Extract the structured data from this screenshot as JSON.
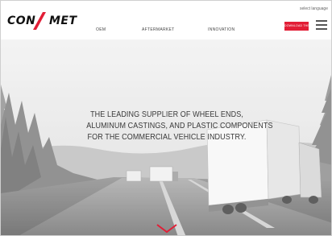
{
  "header": {
    "language_label": "select language",
    "logo": {
      "left": "CON",
      "right": "MET",
      "accent_color": "#e21e36"
    },
    "nav": [
      {
        "label": "OEM"
      },
      {
        "label": "AFTERMARKET"
      },
      {
        "label": "INNOVATION"
      }
    ],
    "download_button": "DOWNLOAD THE APP",
    "menu_icon": "hamburger-menu-icon"
  },
  "hero": {
    "headline": [
      "THE LEADING SUPPLIER OF WHEEL ENDS,",
      "ALUMINUM CASTINGS, AND PLASTIC COMPONENTS",
      "FOR THE COMMERCIAL VEHICLE INDUSTRY."
    ],
    "scroll_icon": "chevron-down-icon",
    "scroll_color": "#e21e36"
  }
}
